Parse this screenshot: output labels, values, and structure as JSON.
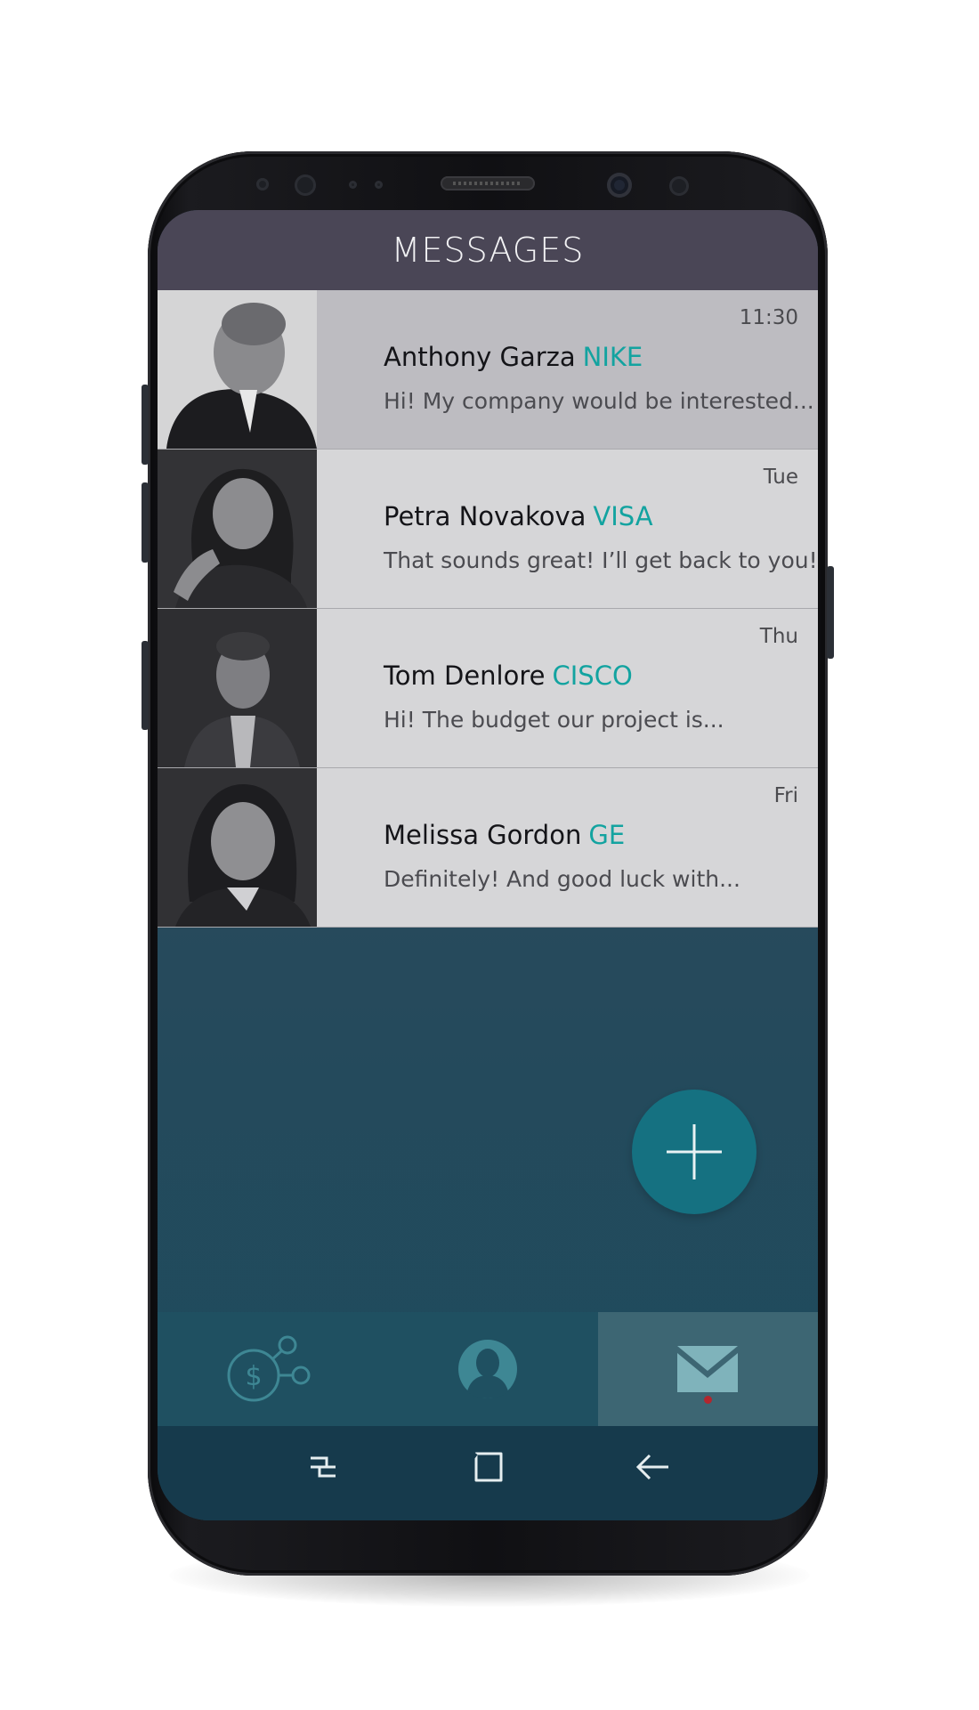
{
  "header": {
    "title": "MESSAGES"
  },
  "messages": [
    {
      "time": "11:30",
      "name": "Anthony Garza",
      "company": "NIKE",
      "preview": "Hi! My company would be interested...",
      "selected": true
    },
    {
      "time": "Tue",
      "name": "Petra Novakova",
      "company": "VISA",
      "preview": "That sounds great! I’ll get back to you!",
      "selected": false
    },
    {
      "time": "Thu",
      "name": "Tom Denlore",
      "company": "CISCO",
      "preview": "Hi! The budget our project is...",
      "selected": false
    },
    {
      "time": "Fri",
      "name": "Melissa Gordon",
      "company": "GE",
      "preview": "Definitely! And good luck with...",
      "selected": false
    }
  ],
  "fab": {
    "icon": "plus-icon"
  },
  "bottom_nav": {
    "tabs": [
      {
        "icon": "finance-network-icon",
        "active": false
      },
      {
        "icon": "profile-icon",
        "active": false
      },
      {
        "icon": "mail-icon",
        "active": true
      }
    ]
  },
  "system_nav": {
    "buttons": [
      {
        "icon": "recent-apps-icon"
      },
      {
        "icon": "home-icon"
      },
      {
        "icon": "back-icon"
      }
    ]
  },
  "colors": {
    "accent": "#13a3a0",
    "header_bg": "#4a4656",
    "fab_bg": "#157181",
    "active_dot": "#b3262e"
  }
}
